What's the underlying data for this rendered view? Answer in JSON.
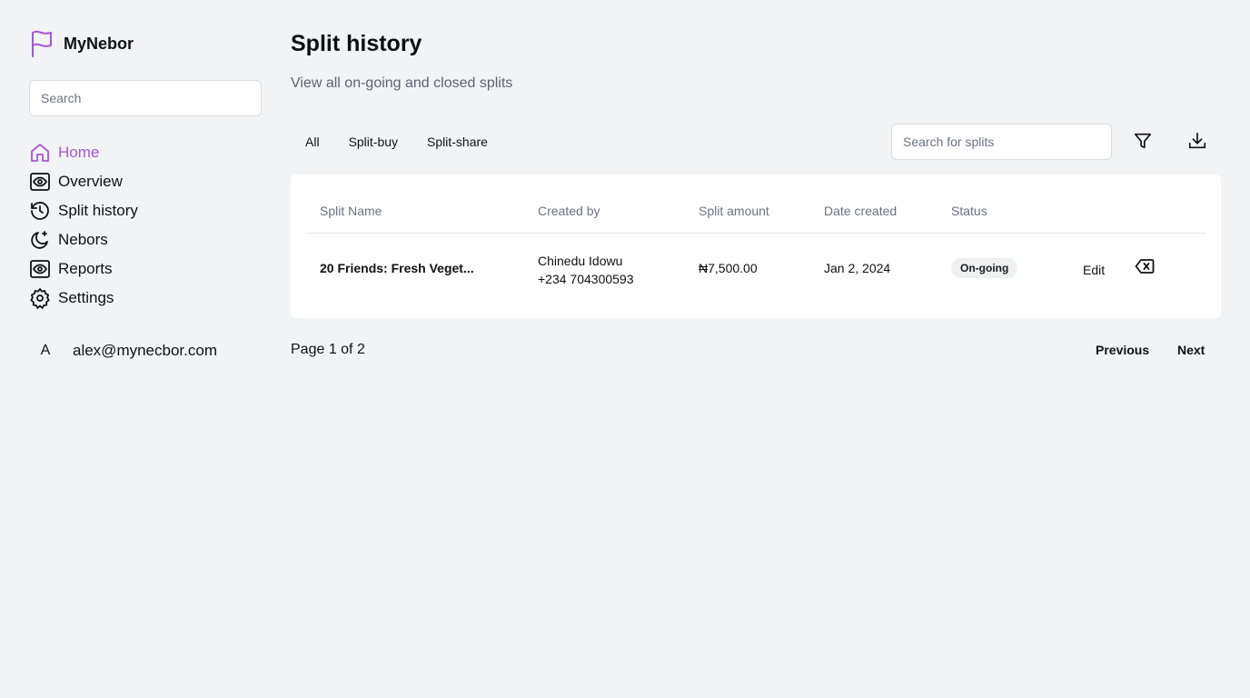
{
  "brand": {
    "name": "MyNebor",
    "accent": "#a855d6"
  },
  "sidebar": {
    "search_placeholder": "Search",
    "items": [
      {
        "label": "Home",
        "icon": "home-icon",
        "active": true
      },
      {
        "label": "Overview",
        "icon": "eye-icon"
      },
      {
        "label": "Split history",
        "icon": "history-icon"
      },
      {
        "label": "Nebors",
        "icon": "moon-icon"
      },
      {
        "label": "Reports",
        "icon": "eye-icon"
      },
      {
        "label": "Settings",
        "icon": "gear-icon"
      }
    ],
    "user": {
      "initial": "A",
      "email": "alex@mynecbor.com"
    }
  },
  "main": {
    "title": "Split history",
    "subtitle": "View all on-going and closed splits",
    "tabs": [
      "All",
      "Split-buy",
      "Split-share"
    ],
    "search_placeholder": "Search for splits",
    "table": {
      "columns": [
        "Split Name",
        "Created by",
        "Split amount",
        "Date created",
        "Status"
      ],
      "rows": [
        {
          "name": "20 Friends: Fresh Veget...",
          "creator_name": "Chinedu Idowu",
          "creator_phone": "+234 704300593",
          "amount": "₦7,500.00",
          "date": "Jan 2, 2024",
          "status": "On-going",
          "edit_label": "Edit"
        }
      ]
    },
    "pagination": {
      "info": "Page 1 of 2",
      "prev": "Previous",
      "next": "Next"
    }
  }
}
